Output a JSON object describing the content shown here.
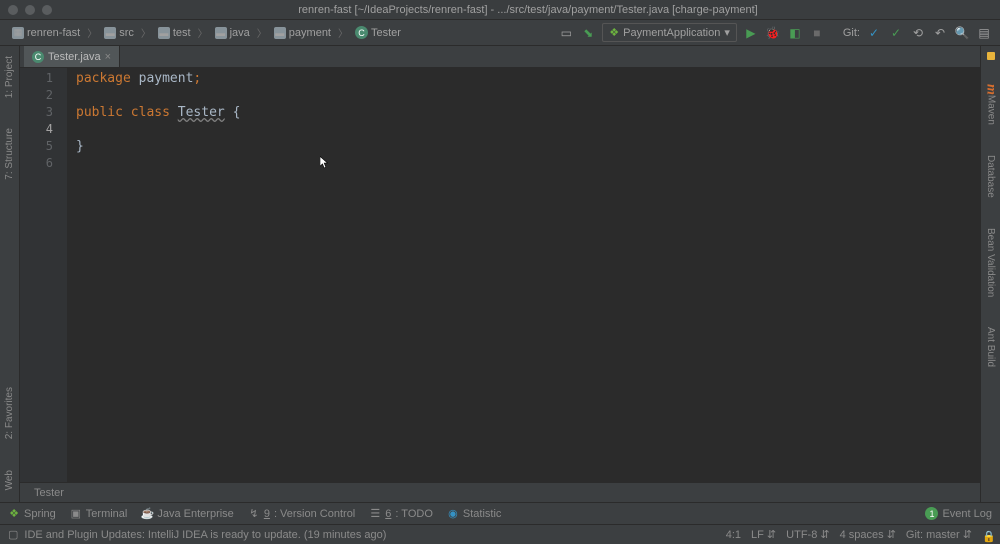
{
  "window": {
    "title": "renren-fast [~/IdeaProjects/renren-fast] - .../src/test/java/payment/Tester.java [charge-payment]"
  },
  "breadcrumbs": {
    "items": [
      {
        "label": "renren-fast",
        "icon": "module"
      },
      {
        "label": "src",
        "icon": "folder"
      },
      {
        "label": "test",
        "icon": "folder"
      },
      {
        "label": "java",
        "icon": "folder"
      },
      {
        "label": "payment",
        "icon": "folder"
      },
      {
        "label": "Tester",
        "icon": "class"
      }
    ]
  },
  "run_config": {
    "label": "PaymentApplication"
  },
  "git_label": "Git:",
  "tab": {
    "label": "Tester.java"
  },
  "code": {
    "line1_kw": "package",
    "line1_rest": " payment",
    "line1_semi": ";",
    "line3_kw1": "public",
    "line3_kw2": "class",
    "line3_class": "Tester",
    "line3_brace": "{",
    "line5_brace": "}"
  },
  "line_numbers": [
    "1",
    "2",
    "3",
    "4",
    "5",
    "6"
  ],
  "editor_breadcrumb": "Tester",
  "left_sidebar": {
    "items": [
      "1: Project",
      "7: Structure",
      "2: Favorites",
      "Web"
    ]
  },
  "right_sidebar": {
    "items": [
      "Maven",
      "Database",
      "Bean Validation",
      "Ant Build"
    ]
  },
  "bottom_tools": {
    "spring": "Spring",
    "terminal": "Terminal",
    "java_ent": "Java Enterprise",
    "vcs_prefix": "9",
    "vcs_label": ": Version Control",
    "todo_prefix": "6",
    "todo_label": ": TODO",
    "statistic": "Statistic",
    "event_log": "Event Log",
    "event_count": "1"
  },
  "status": {
    "message": "IDE and Plugin Updates: IntelliJ IDEA is ready to update. (19 minutes ago)",
    "position": "4:1",
    "line_ending": "LF",
    "encoding": "UTF-8",
    "indent": "4 spaces",
    "git_branch": "Git: master"
  }
}
